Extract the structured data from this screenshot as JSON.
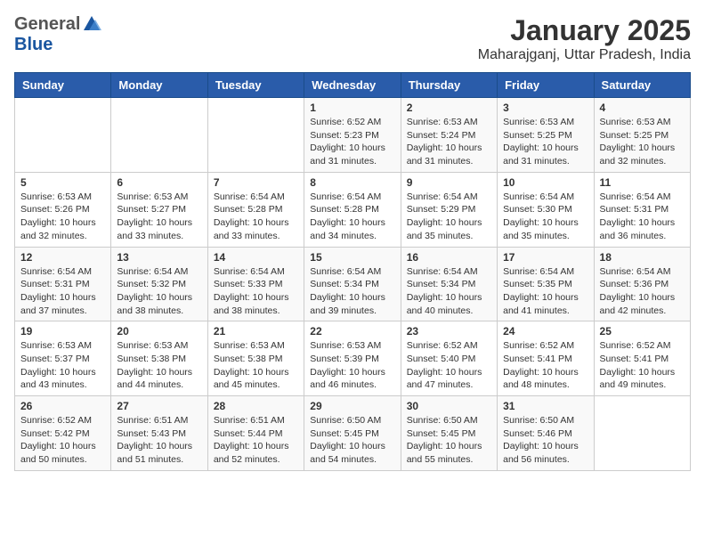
{
  "header": {
    "logo": {
      "line1": "General",
      "line2": "Blue"
    },
    "title": "January 2025",
    "subtitle": "Maharajganj, Uttar Pradesh, India"
  },
  "weekdays": [
    "Sunday",
    "Monday",
    "Tuesday",
    "Wednesday",
    "Thursday",
    "Friday",
    "Saturday"
  ],
  "weeks": [
    [
      {
        "day": "",
        "sunrise": "",
        "sunset": "",
        "daylight": ""
      },
      {
        "day": "",
        "sunrise": "",
        "sunset": "",
        "daylight": ""
      },
      {
        "day": "",
        "sunrise": "",
        "sunset": "",
        "daylight": ""
      },
      {
        "day": "1",
        "sunrise": "Sunrise: 6:52 AM",
        "sunset": "Sunset: 5:23 PM",
        "daylight": "Daylight: 10 hours and 31 minutes."
      },
      {
        "day": "2",
        "sunrise": "Sunrise: 6:53 AM",
        "sunset": "Sunset: 5:24 PM",
        "daylight": "Daylight: 10 hours and 31 minutes."
      },
      {
        "day": "3",
        "sunrise": "Sunrise: 6:53 AM",
        "sunset": "Sunset: 5:25 PM",
        "daylight": "Daylight: 10 hours and 31 minutes."
      },
      {
        "day": "4",
        "sunrise": "Sunrise: 6:53 AM",
        "sunset": "Sunset: 5:25 PM",
        "daylight": "Daylight: 10 hours and 32 minutes."
      }
    ],
    [
      {
        "day": "5",
        "sunrise": "Sunrise: 6:53 AM",
        "sunset": "Sunset: 5:26 PM",
        "daylight": "Daylight: 10 hours and 32 minutes."
      },
      {
        "day": "6",
        "sunrise": "Sunrise: 6:53 AM",
        "sunset": "Sunset: 5:27 PM",
        "daylight": "Daylight: 10 hours and 33 minutes."
      },
      {
        "day": "7",
        "sunrise": "Sunrise: 6:54 AM",
        "sunset": "Sunset: 5:28 PM",
        "daylight": "Daylight: 10 hours and 33 minutes."
      },
      {
        "day": "8",
        "sunrise": "Sunrise: 6:54 AM",
        "sunset": "Sunset: 5:28 PM",
        "daylight": "Daylight: 10 hours and 34 minutes."
      },
      {
        "day": "9",
        "sunrise": "Sunrise: 6:54 AM",
        "sunset": "Sunset: 5:29 PM",
        "daylight": "Daylight: 10 hours and 35 minutes."
      },
      {
        "day": "10",
        "sunrise": "Sunrise: 6:54 AM",
        "sunset": "Sunset: 5:30 PM",
        "daylight": "Daylight: 10 hours and 35 minutes."
      },
      {
        "day": "11",
        "sunrise": "Sunrise: 6:54 AM",
        "sunset": "Sunset: 5:31 PM",
        "daylight": "Daylight: 10 hours and 36 minutes."
      }
    ],
    [
      {
        "day": "12",
        "sunrise": "Sunrise: 6:54 AM",
        "sunset": "Sunset: 5:31 PM",
        "daylight": "Daylight: 10 hours and 37 minutes."
      },
      {
        "day": "13",
        "sunrise": "Sunrise: 6:54 AM",
        "sunset": "Sunset: 5:32 PM",
        "daylight": "Daylight: 10 hours and 38 minutes."
      },
      {
        "day": "14",
        "sunrise": "Sunrise: 6:54 AM",
        "sunset": "Sunset: 5:33 PM",
        "daylight": "Daylight: 10 hours and 38 minutes."
      },
      {
        "day": "15",
        "sunrise": "Sunrise: 6:54 AM",
        "sunset": "Sunset: 5:34 PM",
        "daylight": "Daylight: 10 hours and 39 minutes."
      },
      {
        "day": "16",
        "sunrise": "Sunrise: 6:54 AM",
        "sunset": "Sunset: 5:34 PM",
        "daylight": "Daylight: 10 hours and 40 minutes."
      },
      {
        "day": "17",
        "sunrise": "Sunrise: 6:54 AM",
        "sunset": "Sunset: 5:35 PM",
        "daylight": "Daylight: 10 hours and 41 minutes."
      },
      {
        "day": "18",
        "sunrise": "Sunrise: 6:54 AM",
        "sunset": "Sunset: 5:36 PM",
        "daylight": "Daylight: 10 hours and 42 minutes."
      }
    ],
    [
      {
        "day": "19",
        "sunrise": "Sunrise: 6:53 AM",
        "sunset": "Sunset: 5:37 PM",
        "daylight": "Daylight: 10 hours and 43 minutes."
      },
      {
        "day": "20",
        "sunrise": "Sunrise: 6:53 AM",
        "sunset": "Sunset: 5:38 PM",
        "daylight": "Daylight: 10 hours and 44 minutes."
      },
      {
        "day": "21",
        "sunrise": "Sunrise: 6:53 AM",
        "sunset": "Sunset: 5:38 PM",
        "daylight": "Daylight: 10 hours and 45 minutes."
      },
      {
        "day": "22",
        "sunrise": "Sunrise: 6:53 AM",
        "sunset": "Sunset: 5:39 PM",
        "daylight": "Daylight: 10 hours and 46 minutes."
      },
      {
        "day": "23",
        "sunrise": "Sunrise: 6:52 AM",
        "sunset": "Sunset: 5:40 PM",
        "daylight": "Daylight: 10 hours and 47 minutes."
      },
      {
        "day": "24",
        "sunrise": "Sunrise: 6:52 AM",
        "sunset": "Sunset: 5:41 PM",
        "daylight": "Daylight: 10 hours and 48 minutes."
      },
      {
        "day": "25",
        "sunrise": "Sunrise: 6:52 AM",
        "sunset": "Sunset: 5:41 PM",
        "daylight": "Daylight: 10 hours and 49 minutes."
      }
    ],
    [
      {
        "day": "26",
        "sunrise": "Sunrise: 6:52 AM",
        "sunset": "Sunset: 5:42 PM",
        "daylight": "Daylight: 10 hours and 50 minutes."
      },
      {
        "day": "27",
        "sunrise": "Sunrise: 6:51 AM",
        "sunset": "Sunset: 5:43 PM",
        "daylight": "Daylight: 10 hours and 51 minutes."
      },
      {
        "day": "28",
        "sunrise": "Sunrise: 6:51 AM",
        "sunset": "Sunset: 5:44 PM",
        "daylight": "Daylight: 10 hours and 52 minutes."
      },
      {
        "day": "29",
        "sunrise": "Sunrise: 6:50 AM",
        "sunset": "Sunset: 5:45 PM",
        "daylight": "Daylight: 10 hours and 54 minutes."
      },
      {
        "day": "30",
        "sunrise": "Sunrise: 6:50 AM",
        "sunset": "Sunset: 5:45 PM",
        "daylight": "Daylight: 10 hours and 55 minutes."
      },
      {
        "day": "31",
        "sunrise": "Sunrise: 6:50 AM",
        "sunset": "Sunset: 5:46 PM",
        "daylight": "Daylight: 10 hours and 56 minutes."
      },
      {
        "day": "",
        "sunrise": "",
        "sunset": "",
        "daylight": ""
      }
    ]
  ]
}
